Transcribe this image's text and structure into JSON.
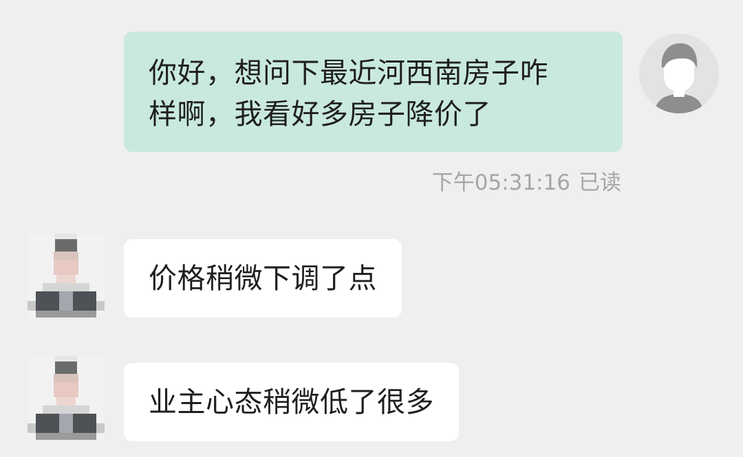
{
  "conversation": {
    "outgoing": {
      "lines": [
        "你好，想问下最近河西南房子咋",
        "样啊，我看好多房子降价了"
      ],
      "timestamp": "下午05:31:16",
      "read_status": "已读"
    },
    "incoming": [
      {
        "text": "价格稍微下调了点"
      },
      {
        "text": "业主心态稍微低了很多"
      }
    ]
  },
  "icons": {
    "my_avatar": "default-person-avatar-icon",
    "agent_avatar": "pixelated-agent-avatar"
  },
  "colors": {
    "background": "#efefef",
    "outgoing_bubble": "#c9e9dd",
    "incoming_bubble": "#ffffff",
    "meta_text": "#a6a6a6"
  }
}
